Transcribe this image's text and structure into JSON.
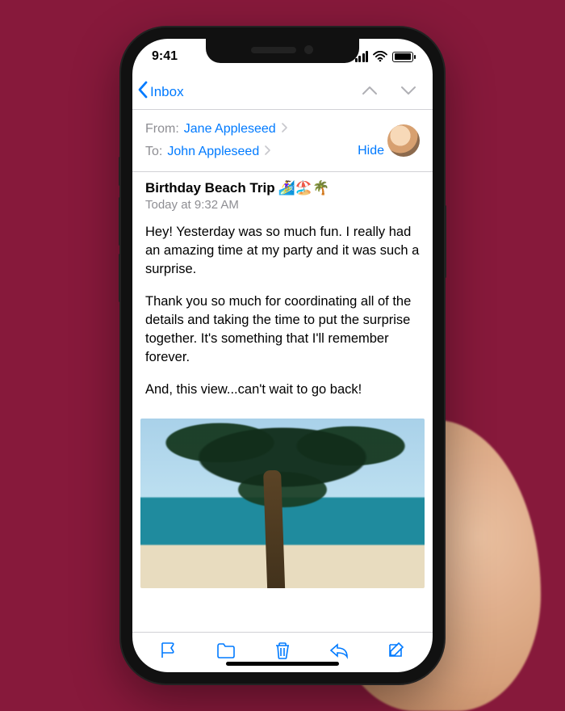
{
  "status": {
    "time": "9:41"
  },
  "nav": {
    "back_label": "Inbox"
  },
  "header": {
    "from_label": "From:",
    "from_name": "Jane Appleseed",
    "to_label": "To:",
    "to_name": "John Appleseed",
    "hide_label": "Hide"
  },
  "subject": {
    "text": "Birthday Beach Trip",
    "emoji": "🏄‍♀️🏖️🌴",
    "timestamp": "Today at 9:32 AM"
  },
  "body": {
    "p1": "Hey! Yesterday was so much fun. I really had an amazing time at my party and it was such a surprise.",
    "p2": "Thank you so much for coordinating all of the details and taking the time to put the surprise together. It's something that I'll remember forever.",
    "p3": "And, this view...can't wait to go back!"
  },
  "icons": {
    "flag": "flag-icon",
    "folder": "folder-icon",
    "trash": "trash-icon",
    "reply": "reply-icon",
    "compose": "compose-icon"
  }
}
